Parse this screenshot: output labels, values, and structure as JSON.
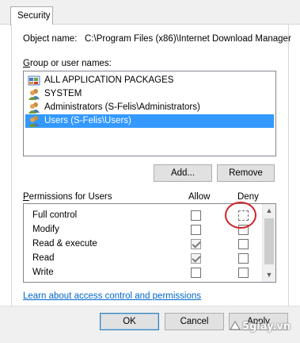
{
  "tab": {
    "label": "Security"
  },
  "object": {
    "label": "Object name:",
    "value": "C:\\Program Files (x86)\\Internet Download Manager"
  },
  "groups": {
    "label_prefix": "G",
    "label_rest": "roup or user names:",
    "items": [
      {
        "name": "ALL APPLICATION PACKAGES",
        "icon": "packages-icon",
        "selected": false
      },
      {
        "name": "SYSTEM",
        "icon": "users-icon",
        "selected": false
      },
      {
        "name": "Administrators (S-Felis\\Administrators)",
        "icon": "users-icon",
        "selected": false
      },
      {
        "name": "Users (S-Felis\\Users)",
        "icon": "users-icon",
        "selected": true
      }
    ]
  },
  "buttons": {
    "add": "Add...",
    "remove": "Remove",
    "ok": "OK",
    "cancel": "Cancel",
    "apply": "Apply"
  },
  "permissions": {
    "label_prefix": "P",
    "label_rest": "ermissions for Users",
    "allow_header": "Allow",
    "deny_header": "Deny",
    "rows": [
      {
        "name": "Full control",
        "allow": false,
        "deny": false
      },
      {
        "name": "Modify",
        "allow": false,
        "deny": false
      },
      {
        "name": "Read & execute",
        "allow": true,
        "deny": false
      },
      {
        "name": "Read",
        "allow": true,
        "deny": false
      },
      {
        "name": "Write",
        "allow": false,
        "deny": false
      }
    ]
  },
  "link": {
    "text": "Learn about access control and permissions"
  },
  "watermark": {
    "text": "5giay.vn"
  },
  "colors": {
    "selection": "#3399ff",
    "highlight_circle": "#d2232a",
    "link": "#0066cc"
  }
}
